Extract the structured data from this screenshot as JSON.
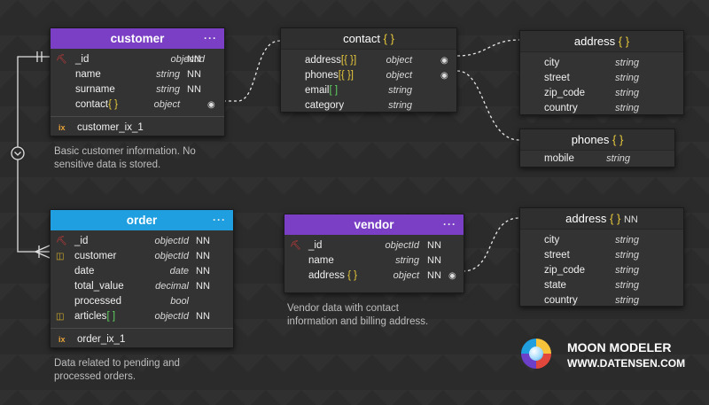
{
  "customer": {
    "title": "customer",
    "menu": "···",
    "fields": [
      {
        "key": "pk",
        "name": "_id",
        "type": "objectId",
        "nn": "NN"
      },
      {
        "key": "",
        "name": "name",
        "type": "string",
        "nn": "NN"
      },
      {
        "key": "",
        "name": "surname",
        "type": "string",
        "nn": "NN"
      },
      {
        "key": "",
        "name": "contact",
        "suffix": "{ }",
        "type": "object",
        "nn": "",
        "eye": true
      }
    ],
    "index": {
      "icon": "ix",
      "name": "customer_ix_1"
    },
    "note": [
      "Basic customer information. No",
      "sensitive data is stored."
    ]
  },
  "order": {
    "title": "order",
    "menu": "···",
    "fields": [
      {
        "key": "pk",
        "name": "_id",
        "type": "objectId",
        "nn": "NN"
      },
      {
        "key": "fk",
        "name": "customer",
        "type": "objectId",
        "nn": "NN"
      },
      {
        "key": "",
        "name": "date",
        "type": "date",
        "nn": "NN"
      },
      {
        "key": "",
        "name": "total_value",
        "type": "decimal",
        "nn": "NN"
      },
      {
        "key": "",
        "name": "processed",
        "type": "bool",
        "nn": ""
      },
      {
        "key": "fk",
        "name": "articles",
        "suffix": "[ ]",
        "type": "objectId",
        "nn": "NN"
      }
    ],
    "index": {
      "icon": "ix",
      "name": "order_ix_1"
    },
    "note": [
      "Data related to pending and",
      "processed orders."
    ]
  },
  "contact": {
    "title": "contact",
    "suffix": "{ }",
    "fields": [
      {
        "name": "address",
        "suffix": "[{ }]",
        "type": "object",
        "eye": true
      },
      {
        "name": "phones",
        "suffix": "[{ }]",
        "type": "object",
        "eye": true
      },
      {
        "name": "email",
        "suffix": "[ ]",
        "type": "string"
      },
      {
        "name": "category",
        "type": "string"
      }
    ]
  },
  "address1": {
    "title": "address",
    "suffix": "{ }",
    "fields": [
      {
        "name": "city",
        "type": "string"
      },
      {
        "name": "street",
        "type": "string"
      },
      {
        "name": "zip_code",
        "type": "string"
      },
      {
        "name": "country",
        "type": "string"
      }
    ]
  },
  "phones": {
    "title": "phones",
    "suffix": "{ }",
    "fields": [
      {
        "name": "mobile",
        "type": "string"
      }
    ]
  },
  "vendor": {
    "title": "vendor",
    "menu": "···",
    "fields": [
      {
        "key": "pk",
        "name": "_id",
        "type": "objectId",
        "nn": "NN"
      },
      {
        "key": "",
        "name": "name",
        "type": "string",
        "nn": "NN"
      },
      {
        "key": "",
        "name": "address",
        "suffix": "{ }",
        "type": "object",
        "nn": "NN",
        "eye": true
      }
    ],
    "note": [
      "Vendor data with contact",
      "information and billing address."
    ]
  },
  "address2": {
    "title": "address",
    "suffix": "{ }",
    "nn": "NN",
    "fields": [
      {
        "name": "city",
        "type": "string"
      },
      {
        "name": "street",
        "type": "string"
      },
      {
        "name": "zip_code",
        "type": "string"
      },
      {
        "name": "state",
        "type": "string"
      },
      {
        "name": "country",
        "type": "string"
      }
    ]
  },
  "brand": {
    "name": "MOON MODELER",
    "url": "WWW.DATENSEN.COM"
  },
  "colors": {
    "purple": "#7a3fc4",
    "blue": "#1f9fe0",
    "pk": "#e23a3a",
    "fk": "#d7b02a",
    "brace": "#e8c93b",
    "bracket": "#5fd35f"
  }
}
